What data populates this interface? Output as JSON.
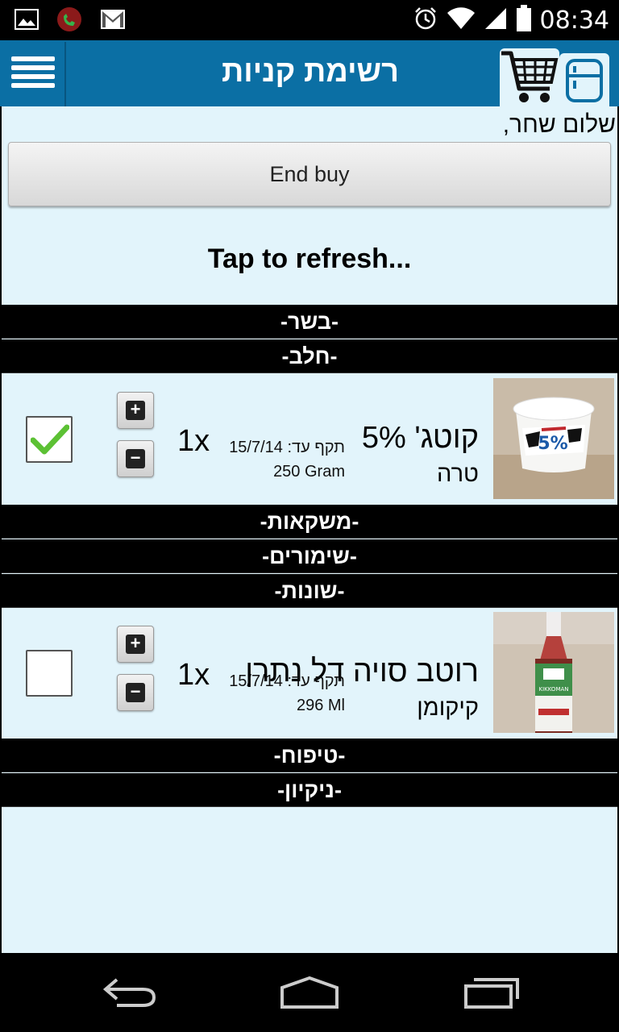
{
  "status_bar": {
    "time": "08:34",
    "left_icons": [
      "gallery-icon",
      "missed-call-icon",
      "gmail-icon"
    ],
    "right_icons": [
      "alarm-icon",
      "wifi-icon",
      "signal-icon",
      "battery-icon"
    ]
  },
  "header": {
    "title": "רשימת קניות",
    "menu_icon": "hamburger-menu-icon",
    "tabs": [
      {
        "name": "cart-tab",
        "icon": "shopping-cart-icon",
        "active": true
      },
      {
        "name": "fridge-tab",
        "icon": "fridge-icon",
        "active": false
      }
    ]
  },
  "greeting": "שלום שחר,",
  "end_buy_label": "End buy",
  "refresh_label": "Tap to refresh...",
  "categories": {
    "meat": "-בשר-",
    "dairy": "-חלב-",
    "drinks": "-משקאות-",
    "canned": "-שימורים-",
    "misc": "-שונות-",
    "care": "-טיפוח-",
    "cleaning": "-ניקיון-"
  },
  "items": [
    {
      "name": "קוטג' 5%",
      "brand": "טרה",
      "expiry": "תקף עד: 15/7/14",
      "size": "250 Gram",
      "quantity": "1x",
      "checked": true
    },
    {
      "name": "רוטב סויה דל נתרן",
      "brand": "קיקומן",
      "expiry": "תקף עד: 15/7/14",
      "size": "296 Ml",
      "quantity": "1x",
      "checked": false
    }
  ],
  "colors": {
    "header_bg": "#0b6fa4",
    "content_bg": "#e2f4fb",
    "category_bg": "#000000",
    "check_green": "#5cc134"
  },
  "nav": [
    "back-icon",
    "home-icon",
    "recent-apps-icon"
  ]
}
